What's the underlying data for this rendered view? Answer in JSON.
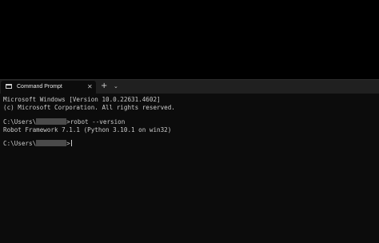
{
  "window": {
    "tab_title": "Command Prompt",
    "close_glyph": "✕",
    "new_tab_glyph": "+",
    "dropdown_glyph": "⌄"
  },
  "console": {
    "line1": "Microsoft Windows [Version 10.0.22631.4602]",
    "line2": "(c) Microsoft Corporation. All rights reserved.",
    "prompt_prefix": "C:\\Users\\",
    "command": ">robot --version",
    "output": "Robot Framework 7.1.1 (Python 3.10.1 on win32)",
    "prompt_end": ">"
  },
  "icons": {
    "tab_icon": "terminal-icon",
    "close_icon": "close-icon",
    "new_tab_icon": "plus-icon",
    "dropdown_icon": "chevron-down-icon"
  },
  "colors": {
    "background": "#000000",
    "console_bg": "#0c0c0c",
    "titlebar_bg": "#202020",
    "text": "#cccccc"
  }
}
